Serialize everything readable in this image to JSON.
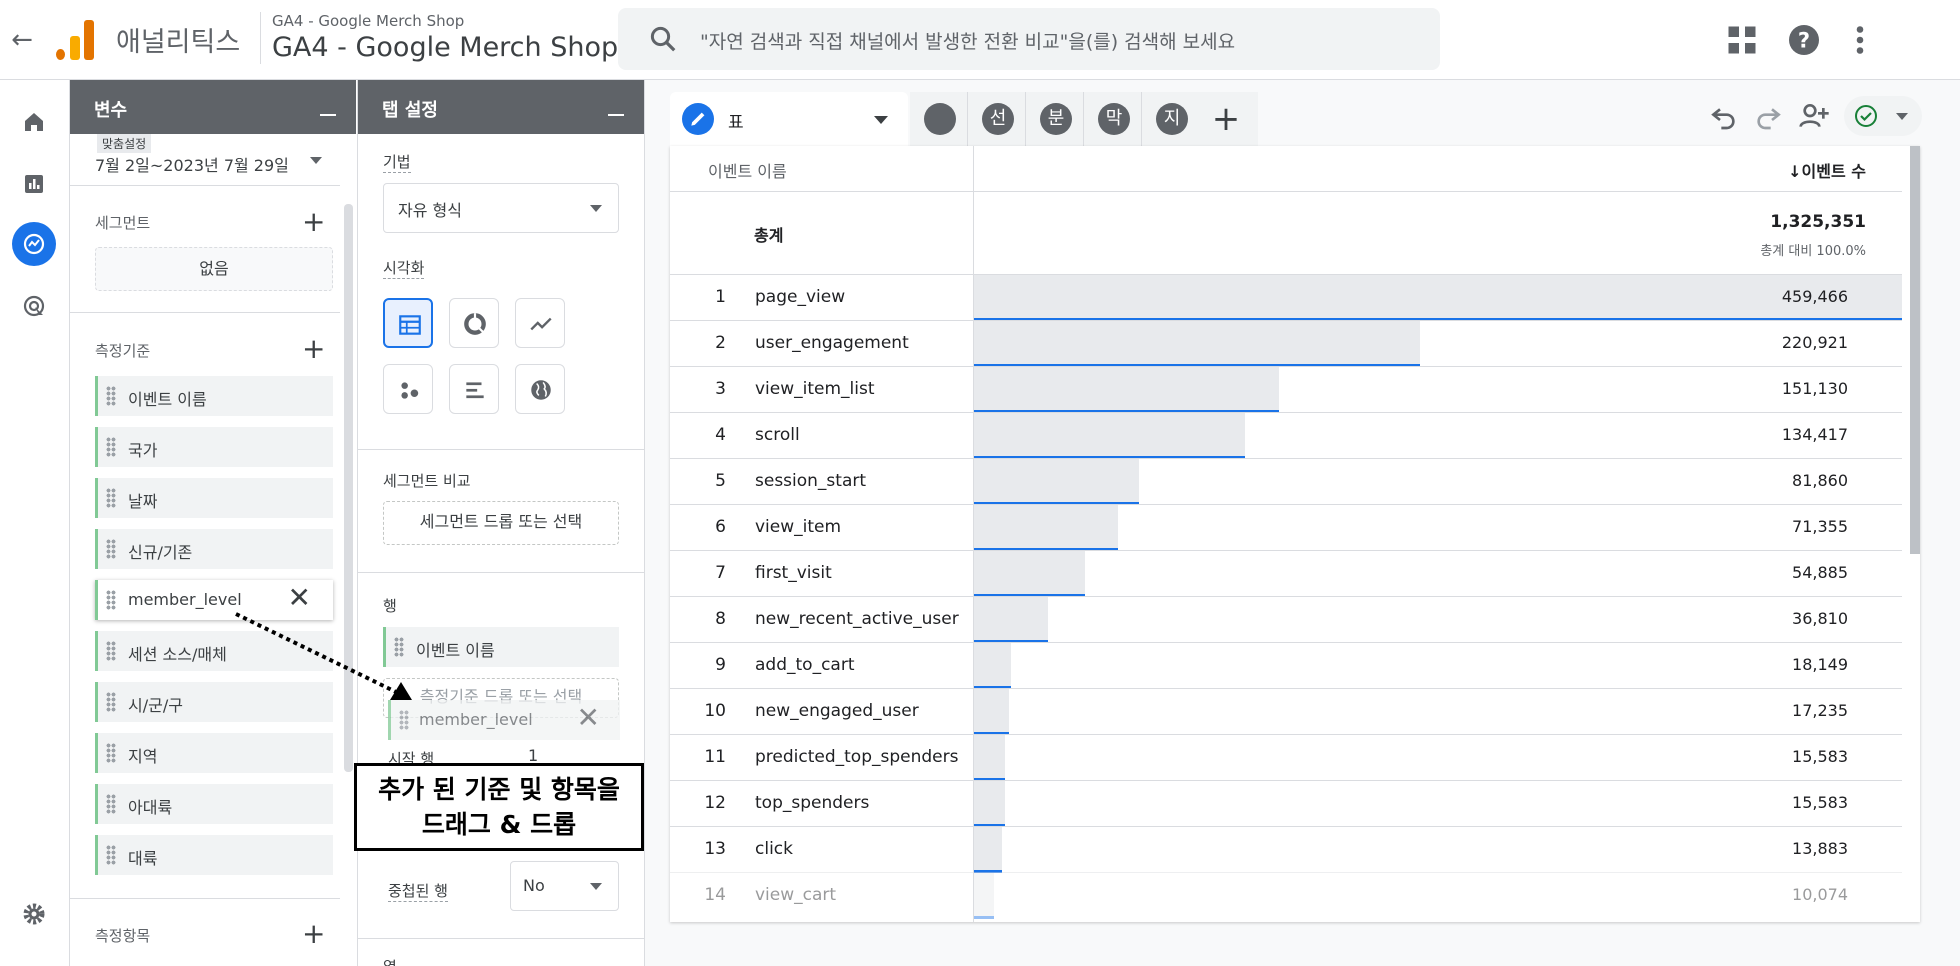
{
  "header": {
    "app_name": "애널리틱스",
    "account_sub": "GA4 - Google Merch Shop",
    "account_title": "GA4 - Google Merch Shop",
    "search_placeholder": "\"자연 검색과 직접 채널에서 발생한 전환 비교\"을(를) 검색해 보세요"
  },
  "variables": {
    "title": "변수",
    "date_tag": "맞춤설정",
    "date_range": "7월 2일~2023년 7월 29일",
    "segments_label": "세그먼트",
    "segments_none": "없음",
    "dimensions_label": "측정기준",
    "dimensions": [
      "이벤트 이름",
      "국가",
      "날짜",
      "신규/기존",
      "member_level",
      "세션 소스/매체",
      "시/군/구",
      "지역",
      "아대륙",
      "대륙"
    ],
    "metrics_label": "측정항목"
  },
  "tab_settings": {
    "title": "탭 설정",
    "technique_label": "기법",
    "technique_value": "자유 형식",
    "viz_label": "시각화",
    "segment_compare_label": "세그먼트 비교",
    "segment_drop": "세그먼트 드롭 또는 선택",
    "rows_label": "행",
    "row_item": "이벤트 이름",
    "dim_drop": "측정기준 드롭 또는 선택",
    "dragging_item": "member_level",
    "start_row_label": "시작 행",
    "start_row_value": "1",
    "nested_label": "중첩된 행",
    "nested_value": "No",
    "next_label": "열"
  },
  "callout": {
    "line1": "추가 된 기준 및 항목을",
    "line2": "드래그 & 드롭"
  },
  "tabs": {
    "active": "표",
    "others": [
      "",
      "선",
      "분",
      "막",
      "지"
    ]
  },
  "table": {
    "col_dim": "이벤트 이름",
    "col_metric": "↓이벤트 수",
    "total_label": "총계",
    "total_value": "1,325,351",
    "total_sub": "총계 대비 100.0%",
    "rows": [
      {
        "n": "1",
        "name": "page_view",
        "value": "459,466",
        "v": 459466
      },
      {
        "n": "2",
        "name": "user_engagement",
        "value": "220,921",
        "v": 220921
      },
      {
        "n": "3",
        "name": "view_item_list",
        "value": "151,130",
        "v": 151130
      },
      {
        "n": "4",
        "name": "scroll",
        "value": "134,417",
        "v": 134417
      },
      {
        "n": "5",
        "name": "session_start",
        "value": "81,860",
        "v": 81860
      },
      {
        "n": "6",
        "name": "view_item",
        "value": "71,355",
        "v": 71355
      },
      {
        "n": "7",
        "name": "first_visit",
        "value": "54,885",
        "v": 54885
      },
      {
        "n": "8",
        "name": "new_recent_active_user",
        "value": "36,810",
        "v": 36810
      },
      {
        "n": "9",
        "name": "add_to_cart",
        "value": "18,149",
        "v": 18149
      },
      {
        "n": "10",
        "name": "new_engaged_user",
        "value": "17,235",
        "v": 17235
      },
      {
        "n": "11",
        "name": "predicted_top_spenders",
        "value": "15,583",
        "v": 15583
      },
      {
        "n": "12",
        "name": "top_spenders",
        "value": "15,583",
        "v": 15583
      },
      {
        "n": "13",
        "name": "click",
        "value": "13,883",
        "v": 13883
      },
      {
        "n": "14",
        "name": "view_cart",
        "value": "10,074",
        "v": 10074
      }
    ]
  },
  "colors": {
    "accent": "#1a73e8",
    "chip_border": "#81c995",
    "panel_header": "#5f6368"
  }
}
